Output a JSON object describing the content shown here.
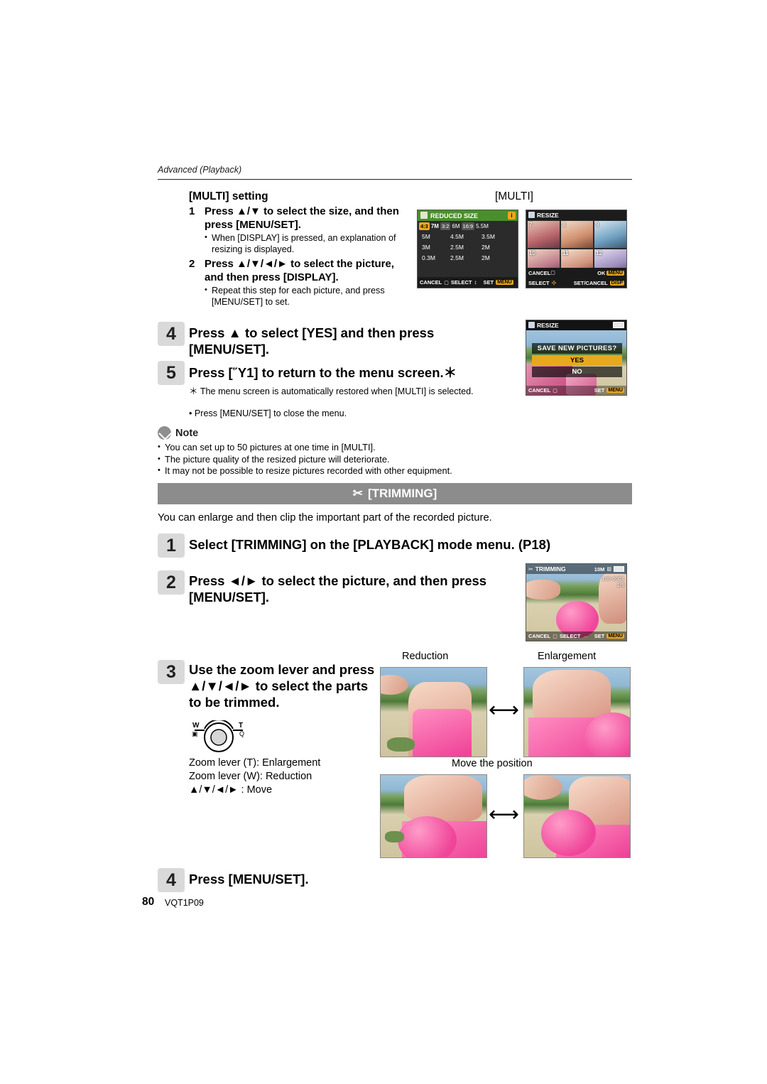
{
  "header": {
    "section": "Advanced (Playback)"
  },
  "multi": {
    "title": "[MULTI] setting",
    "label": "[MULTI]",
    "steps": [
      {
        "num": "1",
        "text": "Press ▲/▼ to select the size, and then press [MENU/SET].",
        "bullets": [
          "When [DISPLAY] is pressed, an explanation of resizing is displayed."
        ]
      },
      {
        "num": "2",
        "text": "Press ▲/▼/◄/► to select the picture, and then press [DISPLAY].",
        "bullets": [
          "Repeat this step for each picture, and press [MENU/SET] to set."
        ]
      }
    ]
  },
  "steps_45": [
    {
      "num": "4",
      "text": "Press ▲ to select [YES] and then press [MENU/SET]."
    },
    {
      "num": "5",
      "text": "Press [Ὕ1] to return to the menu screen.＊"
    }
  ],
  "step5_notes": [
    "＊   The menu screen is automatically restored when [MULTI] is selected.",
    "• Press [MENU/SET] to close the menu."
  ],
  "note": {
    "heading": "Note",
    "lines": [
      "You can set up to 50 pictures at one time in [MULTI].",
      "The picture quality of the resized picture will deteriorate.",
      "It may not be possible to resize pictures recorded with other equipment."
    ]
  },
  "trimming": {
    "band_label": "[TRIMMING]",
    "scissors_icon": "scissors-icon",
    "intro": "You can enlarge and then clip the important part of the recorded picture.",
    "steps": [
      {
        "num": "1",
        "text": "Select [TRIMMING] on the [PLAYBACK] mode menu. (P18)"
      },
      {
        "num": "2",
        "text": "Press ◄/► to select the picture, and then press [MENU/SET]."
      },
      {
        "num": "3",
        "text": "Use the zoom lever and press ▲/▼/◄/► to select the parts to be trimmed."
      },
      {
        "num": "4",
        "text": "Press [MENU/SET]."
      }
    ],
    "lever_captions": [
      "Zoom lever (T): Enlargement",
      "Zoom lever (W): Reduction",
      "▲/▼/◄/► : Move"
    ],
    "lever_labels": {
      "w": "W",
      "t": "T",
      "w_sub": "⬜",
      "t_sub": "Q"
    }
  },
  "figure_captions": {
    "reduction": "Reduction",
    "enlargement": "Enlargement",
    "move": "Move the position"
  },
  "lcd_resize_multi": {
    "title": "REDUCED SIZE",
    "rows": [
      [
        "4:3",
        "7M",
        "3:2",
        "6M",
        "16:9",
        "5.5M"
      ],
      [
        "5M",
        "4.5M",
        "3.5M"
      ],
      [
        "3M",
        "2.5M",
        "2M"
      ],
      [
        "0.3M",
        "2.5M",
        "2M"
      ]
    ],
    "footer_left": "CANCEL",
    "footer_mid": "SELECT",
    "footer_right": "SET"
  },
  "lcd_resize_select": {
    "title": "RESIZE",
    "numbers": [
      "7",
      "8",
      "9",
      "10",
      "11",
      "12"
    ],
    "footer_left": "CANCEL",
    "footer_right": "OK",
    "footer_left2": "SELECT",
    "footer_right2": "SET/CANCEL"
  },
  "lcd_save": {
    "title": "RESIZE",
    "question": "SAVE NEW PICTURES?",
    "yes": "YES",
    "no": "NO",
    "footer_left": "CANCEL",
    "footer_right": "SET",
    "battery": "battery-icon"
  },
  "lcd_trimming": {
    "title": "TRIMMING",
    "size": "10M",
    "counter": "100-0001",
    "page": "1/9",
    "footer_left": "CANCEL",
    "footer_mid": "SELECT",
    "footer_right": "SET"
  },
  "footer": {
    "page": "80",
    "code": "VQT1P09"
  },
  "colors": {
    "band_gray": "#8c8c8c",
    "step_box_gray": "#d9d9d9",
    "lcd_dark": "#111111",
    "lcd_green": "#4a8f2c",
    "lcd_orange": "#e8a81e"
  }
}
